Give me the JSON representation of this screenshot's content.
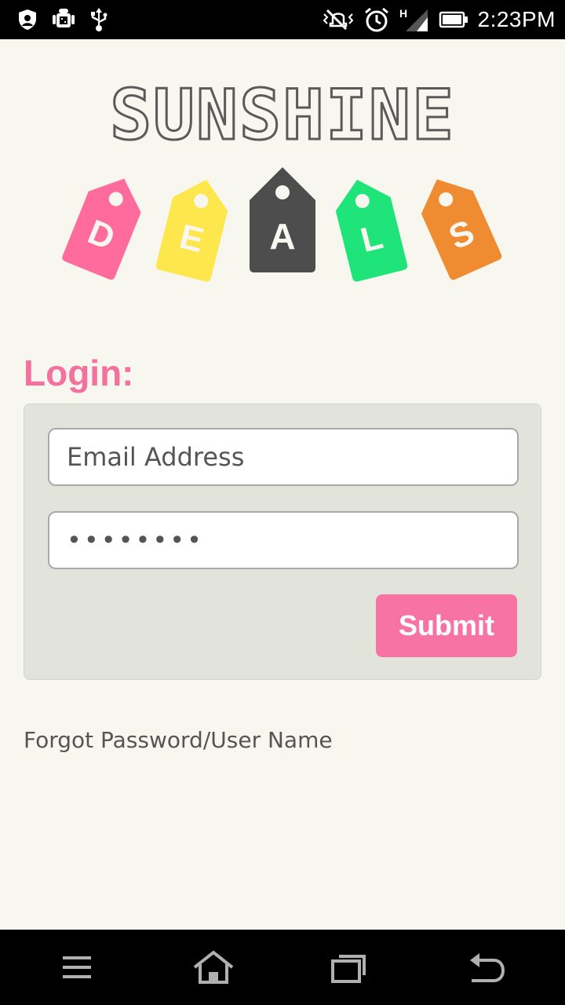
{
  "status_bar": {
    "time": "2:23PM",
    "icons": [
      "shield-icon",
      "android-debug-icon",
      "usb-icon",
      "vibrate-off-icon",
      "alarm-icon",
      "signal-h-icon",
      "battery-icon"
    ],
    "network_type": "H"
  },
  "logo": {
    "wordmark": "SUNSHINE",
    "tags": [
      {
        "letter": "D",
        "color": "#ff6b9d"
      },
      {
        "letter": "E",
        "color": "#fde74c"
      },
      {
        "letter": "A",
        "color": "#4d4d4d"
      },
      {
        "letter": "L",
        "color": "#1ee47a"
      },
      {
        "letter": "S",
        "color": "#ef8c32"
      }
    ]
  },
  "login": {
    "title": "Login:",
    "email_placeholder": "Email Address",
    "password_value": "••••••••",
    "submit_label": "Submit",
    "forgot_link": "Forgot Password/User Name"
  },
  "colors": {
    "accent_pink": "#f773a3",
    "title_pink": "#f4719f",
    "background": "#f7f7f0",
    "panel": "#e2e3db"
  },
  "nav_bar": {
    "buttons": [
      "menu-icon",
      "home-icon",
      "recent-apps-icon",
      "back-icon"
    ]
  }
}
